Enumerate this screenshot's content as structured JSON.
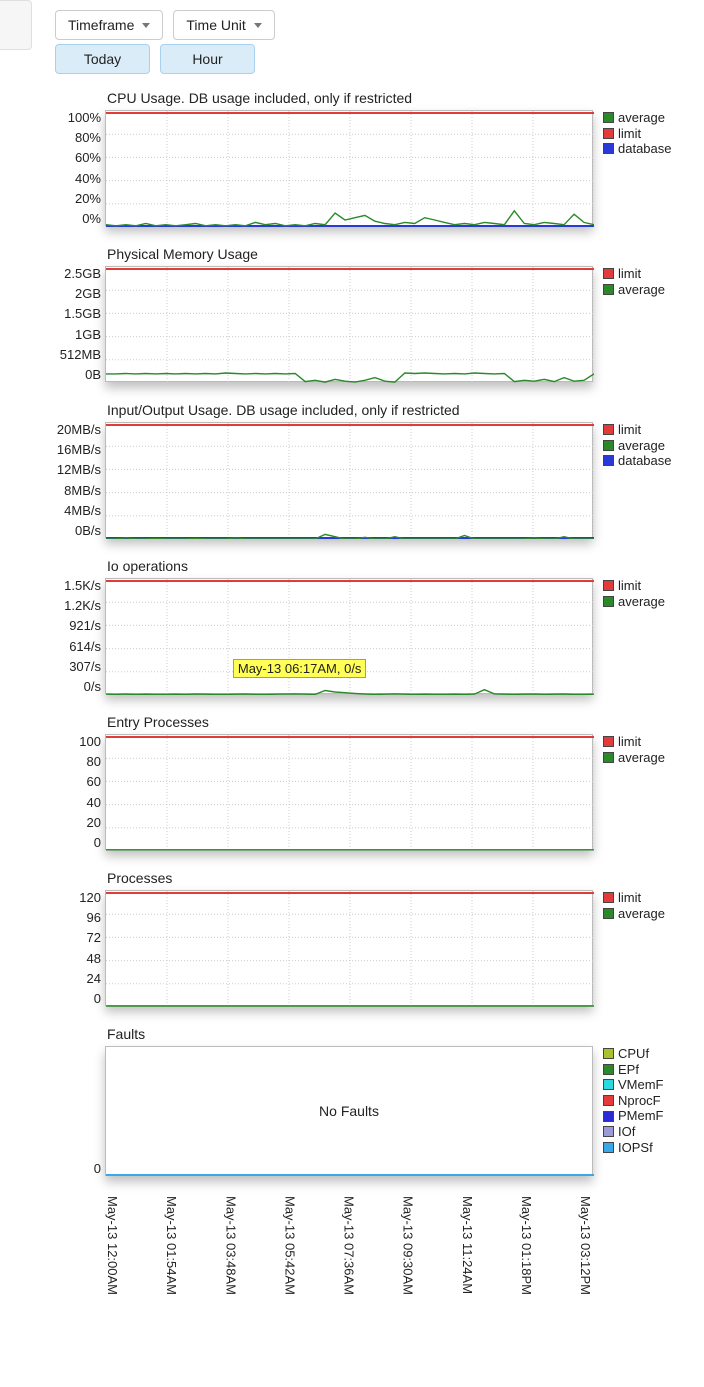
{
  "toolbar": {
    "timeframe_label": "Timeframe",
    "timeunit_label": "Time Unit",
    "timeframe_value": "Today",
    "timeunit_value": "Hour"
  },
  "legend_labels": {
    "average": "average",
    "limit": "limit",
    "database": "database",
    "cpuf": "CPUf",
    "epf": "EPf",
    "vmemf": "VMemF",
    "nprocf": "NprocF",
    "pmemf": "PMemF",
    "iof": "IOf",
    "iopsf": "IOPSf"
  },
  "colors": {
    "average": "#2a8a2a",
    "limit": "#e33a3a",
    "database": "#2a3ad8",
    "cpuf": "#a8c22a",
    "epf": "#2a8a2a",
    "vmemf": "#2ad8e0",
    "nprocf": "#e33a3a",
    "pmemf": "#2a2ad8",
    "iof": "#9a9ad8",
    "iopsf": "#3aa8e8"
  },
  "xaxis": [
    "May-13 12:00AM",
    "May-13 01:54AM",
    "May-13 03:48AM",
    "May-13 05:42AM",
    "May-13 07:36AM",
    "May-13 09:30AM",
    "May-13 11:24AM",
    "May-13 01:18PM",
    "May-13 03:12PM"
  ],
  "tooltip": "May-13 06:17AM, 0/s",
  "faults_msg": "No Faults",
  "chart_data": [
    {
      "title": "CPU Usage. DB usage included, only if restricted",
      "type": "line",
      "ylabels": [
        "100%",
        "80%",
        "60%",
        "40%",
        "20%",
        "0%"
      ],
      "ylim": [
        0,
        100
      ],
      "unit": "%",
      "legend": [
        "average",
        "limit",
        "database"
      ],
      "series": {
        "limit_y": 100,
        "database_y": 0,
        "average": [
          2,
          1,
          2,
          1,
          3,
          1,
          2,
          1,
          2,
          3,
          1,
          2,
          1,
          2,
          1,
          4,
          2,
          3,
          1,
          2,
          1,
          3,
          2,
          12,
          6,
          8,
          10,
          5,
          3,
          2,
          4,
          3,
          8,
          6,
          4,
          2,
          3,
          2,
          4,
          3,
          2,
          14,
          3,
          2,
          4,
          3,
          2,
          11,
          4,
          2
        ]
      }
    },
    {
      "title": "Physical Memory Usage",
      "type": "line",
      "ylabels": [
        "2.5GB",
        "2GB",
        "1.5GB",
        "1GB",
        "512MB",
        "0B"
      ],
      "ylim": [
        0,
        2560
      ],
      "unit": "MB",
      "legend": [
        "limit",
        "average"
      ],
      "series": {
        "limit_y": 2560,
        "average": [
          200,
          200,
          210,
          200,
          210,
          200,
          210,
          200,
          210,
          200,
          210,
          200,
          220,
          210,
          200,
          210,
          200,
          210,
          200,
          210,
          30,
          60,
          20,
          80,
          40,
          20,
          60,
          120,
          40,
          20,
          220,
          210,
          220,
          210,
          200,
          210,
          200,
          220,
          210,
          200,
          210,
          30,
          60,
          40,
          80,
          30,
          120,
          40,
          60,
          200
        ]
      }
    },
    {
      "title": "Input/Output Usage. DB usage included, only if restricted",
      "type": "line",
      "ylabels": [
        "20MB/s",
        "16MB/s",
        "12MB/s",
        "8MB/s",
        "4MB/s",
        "0B/s"
      ],
      "ylim": [
        0,
        20
      ],
      "unit": "MB/s",
      "legend": [
        "limit",
        "average",
        "database"
      ],
      "series": {
        "limit_y": 20,
        "database_y": 0,
        "average": [
          0,
          0,
          0.2,
          0,
          0,
          0.1,
          0,
          0,
          0,
          0.1,
          0,
          0,
          0,
          0.2,
          0,
          0,
          0,
          0,
          0,
          0,
          0,
          0,
          0.8,
          0.4,
          0,
          0,
          0.3,
          0,
          0,
          0.4,
          0,
          0,
          0,
          0,
          0,
          0,
          0.6,
          0,
          0,
          0,
          0,
          0,
          0,
          0.2,
          0,
          0,
          0.4,
          0,
          0,
          0
        ]
      }
    },
    {
      "title": "Io operations",
      "type": "line",
      "ylabels": [
        "1.5K/s",
        "1.2K/s",
        "921/s",
        "614/s",
        "307/s",
        "0/s"
      ],
      "ylim": [
        0,
        1535
      ],
      "unit": "/s",
      "legend": [
        "limit",
        "average"
      ],
      "tooltip_at": 0.26,
      "series": {
        "limit_y": 1535,
        "average": [
          10,
          8,
          12,
          6,
          10,
          8,
          6,
          10,
          8,
          12,
          10,
          8,
          6,
          10,
          12,
          8,
          6,
          10,
          12,
          14,
          10,
          8,
          60,
          40,
          30,
          20,
          12,
          8,
          10,
          14,
          10,
          8,
          10,
          8,
          6,
          10,
          8,
          12,
          70,
          14,
          10,
          8,
          10,
          12,
          8,
          10,
          12,
          8,
          6,
          10
        ]
      }
    },
    {
      "title": "Entry Processes",
      "type": "line",
      "ylabels": [
        "100",
        "80",
        "60",
        "40",
        "20",
        "0"
      ],
      "ylim": [
        0,
        100
      ],
      "unit": "",
      "legend": [
        "limit",
        "average"
      ],
      "series": {
        "limit_y": 100,
        "average": [
          1,
          1,
          1,
          1,
          1,
          1,
          1,
          1,
          1,
          1,
          1,
          1,
          1,
          1,
          1,
          1,
          1,
          1,
          1,
          1,
          1,
          1,
          1,
          1,
          1,
          1,
          1,
          1,
          1,
          1,
          1,
          1,
          1,
          1,
          1,
          1,
          1,
          1,
          1,
          1,
          1,
          1,
          1,
          1,
          1,
          1,
          1,
          1,
          1,
          1
        ]
      }
    },
    {
      "title": "Processes",
      "type": "line",
      "ylabels": [
        "120",
        "96",
        "72",
        "48",
        "24",
        "0"
      ],
      "ylim": [
        0,
        120
      ],
      "unit": "",
      "legend": [
        "limit",
        "average"
      ],
      "series": {
        "limit_y": 120,
        "average": [
          1,
          1,
          1,
          1,
          1,
          1,
          1,
          1,
          1,
          1,
          1,
          1,
          1,
          1,
          1,
          1,
          1,
          1,
          1,
          1,
          1,
          1,
          1,
          1,
          1,
          1,
          1,
          1,
          1,
          1,
          1,
          1,
          1,
          1,
          1,
          1,
          1,
          1,
          1,
          1,
          1,
          1,
          1,
          1,
          1,
          1,
          1,
          1,
          1,
          1
        ]
      }
    },
    {
      "title": "Faults",
      "type": "line",
      "ylabels_single": "0",
      "ylim": [
        0,
        1
      ],
      "unit": "",
      "legend": [
        "cpuf",
        "epf",
        "vmemf",
        "nprocf",
        "pmemf",
        "iof",
        "iopsf"
      ],
      "no_data": true
    }
  ]
}
